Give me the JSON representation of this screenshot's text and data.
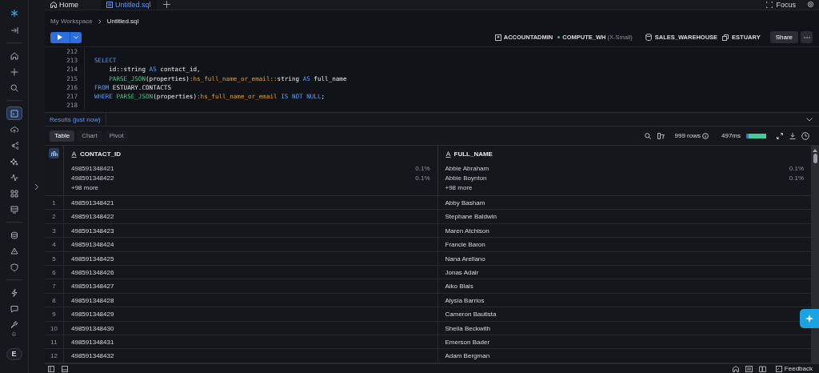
{
  "tabs": [
    {
      "label": "Home",
      "selected": false
    },
    {
      "label": "Untitled.sql",
      "selected": true
    }
  ],
  "top_right": {
    "focus": "Focus"
  },
  "sidebar": {
    "items": [
      {
        "selected": false
      },
      {
        "selected": false
      },
      {
        "selected": false
      },
      {
        "selected": false
      },
      {
        "selected": true
      },
      {
        "selected": false
      },
      {
        "selected": false
      },
      {
        "selected": false
      },
      {
        "selected": false
      },
      {
        "selected": false
      },
      {
        "selected": false
      },
      {
        "selected": false
      },
      {
        "selected": false
      },
      {
        "selected": false
      },
      {
        "selected": false
      },
      {
        "selected": false
      },
      {
        "selected": false
      }
    ],
    "avatar": "E"
  },
  "breadcrumb": [
    "My Workspace",
    "Untitled.sql"
  ],
  "context": {
    "role": "ACCOUNTADMIN",
    "warehouse": "COMPUTE_WH",
    "warehouse_size": "(X-Small)",
    "database": "SALES_WAREHOUSE",
    "schema": "ESTUARY",
    "share": "Share"
  },
  "editor": {
    "lines": [
      {
        "number": "212"
      },
      {
        "number": "213",
        "tokens": [
          {
            "kind": "kw",
            "text": "SELECT"
          }
        ]
      },
      {
        "number": "214",
        "indent": true,
        "tokens": [
          {
            "kind": "plain",
            "text": "id::string "
          },
          {
            "kind": "kw",
            "text": "AS"
          },
          {
            "kind": "plain",
            "text": " contact_id,"
          }
        ]
      },
      {
        "number": "215",
        "indent": true,
        "tokens": [
          {
            "kind": "fn",
            "text": "PARSE_JSON"
          },
          {
            "kind": "plain",
            "text": "(properties)"
          },
          {
            "kind": "prop",
            "text": ":hs_full_name_or_email::"
          },
          {
            "kind": "plain",
            "text": "string "
          },
          {
            "kind": "kw",
            "text": "AS"
          },
          {
            "kind": "plain",
            "text": " full_name"
          }
        ]
      },
      {
        "number": "216",
        "tokens": [
          {
            "kind": "kw",
            "text": "FROM"
          },
          {
            "kind": "plain",
            "text": " ESTUARY.CONTACTS"
          }
        ]
      },
      {
        "number": "217",
        "tokens": [
          {
            "kind": "kw",
            "text": "WHERE "
          },
          {
            "kind": "fn",
            "text": "PARSE_JSON"
          },
          {
            "kind": "plain",
            "text": "(properties)"
          },
          {
            "kind": "prop",
            "text": ":hs_full_name_or_email"
          },
          {
            "kind": "kw",
            "text": " IS NOT NULL"
          },
          {
            "kind": "plain",
            "text": ";"
          }
        ]
      },
      {
        "number": "218"
      }
    ]
  },
  "results": {
    "title": "Results (just now)",
    "views": [
      {
        "label": "Table",
        "selected": true
      },
      {
        "label": "Chart",
        "selected": false
      },
      {
        "label": "Pivot",
        "selected": false
      }
    ],
    "row_count": "999 rows",
    "duration": "497ms",
    "level": 0.12,
    "columns": [
      {
        "name": "CONTACT_ID",
        "top": [
          {
            "value": "498591348421",
            "pct": "0.1%"
          },
          {
            "value": "498591348422",
            "pct": "0.1%"
          }
        ],
        "more": "+98 more"
      },
      {
        "name": "FULL_NAME",
        "top": [
          {
            "value": "Abbie Abraham",
            "pct": "0.1%"
          },
          {
            "value": "Abbie Boynton",
            "pct": "0.1%"
          }
        ],
        "more": "+98 more"
      }
    ],
    "rows": [
      {
        "number": "1",
        "cells": [
          "498591348421",
          "Abby Basham"
        ]
      },
      {
        "number": "2",
        "cells": [
          "498591348422",
          "Stephane Baldwin"
        ]
      },
      {
        "number": "3",
        "cells": [
          "498591348423",
          "Maren Atchison"
        ]
      },
      {
        "number": "4",
        "cells": [
          "498591348424",
          "Francie Baron"
        ]
      },
      {
        "number": "5",
        "cells": [
          "498591348425",
          "Nana Arellano"
        ]
      },
      {
        "number": "6",
        "cells": [
          "498591348426",
          "Jonas Adair"
        ]
      },
      {
        "number": "7",
        "cells": [
          "498591348427",
          "Aiko Blais"
        ]
      },
      {
        "number": "8",
        "cells": [
          "498591348428",
          "Alysia Barrios"
        ]
      },
      {
        "number": "9",
        "cells": [
          "498591348429",
          "Cameron Bautista"
        ]
      },
      {
        "number": "10",
        "cells": [
          "498591348430",
          "Sheila Beckwith"
        ]
      },
      {
        "number": "11",
        "cells": [
          "498591348431",
          "Emerson Bader"
        ]
      },
      {
        "number": "12",
        "cells": [
          "498591348432",
          "Adam Bergman"
        ]
      }
    ]
  },
  "status_bar": {
    "feedback": "Feedback"
  }
}
